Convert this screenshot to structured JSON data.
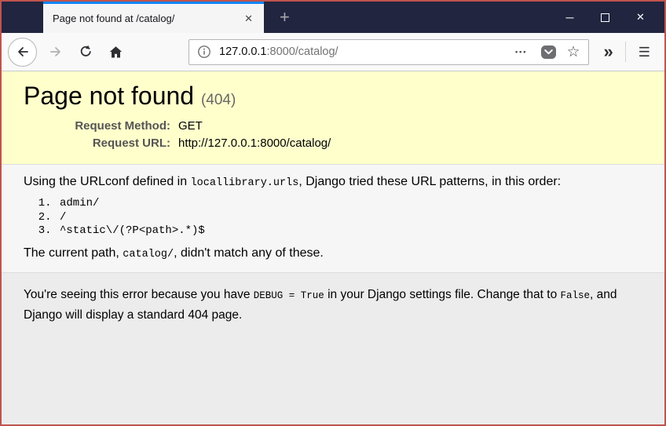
{
  "browser": {
    "tab": {
      "title": "Page not found at /catalog/",
      "close_glyph": "✕",
      "new_tab_glyph": "+"
    },
    "window_controls": {
      "minimize_glyph": "─",
      "close_glyph": "✕"
    },
    "toolbar": {
      "url_host": "127.0.0.1",
      "url_rest": ":8000/catalog/",
      "page_actions_glyph": "•••",
      "bookmark_glyph": "☆",
      "overflow_glyph": "»",
      "menu_glyph": "☰"
    }
  },
  "page": {
    "summary": {
      "title": "Page not found",
      "status": "(404)",
      "meta": [
        {
          "label": "Request Method:",
          "value": "GET"
        },
        {
          "label": "Request URL:",
          "value": "http://127.0.0.1:8000/catalog/"
        }
      ]
    },
    "info": {
      "intro_prefix": "Using the URLconf defined in ",
      "intro_code": "locallibrary.urls",
      "intro_suffix": ", Django tried these URL patterns, in this order:",
      "patterns": [
        "admin/",
        "/",
        "^static\\/(?P<path>.*)$"
      ],
      "current_prefix": "The current path, ",
      "current_code": "catalog/",
      "current_suffix": ", didn't match any of these."
    },
    "explanation": {
      "part1": "You're seeing this error because you have ",
      "code1": "DEBUG = True",
      "part2": " in your Django settings file. Change that to ",
      "code2": "False",
      "part3": ", and Django will display a standard 404 page."
    }
  },
  "colors": {
    "accent_blue": "#0a84ff",
    "titlebar_bg": "#212540",
    "summary_bg": "#ffffcc",
    "info_bg": "#f6f6f6",
    "page_bg": "#ececec",
    "frame_border": "#bf544d"
  }
}
